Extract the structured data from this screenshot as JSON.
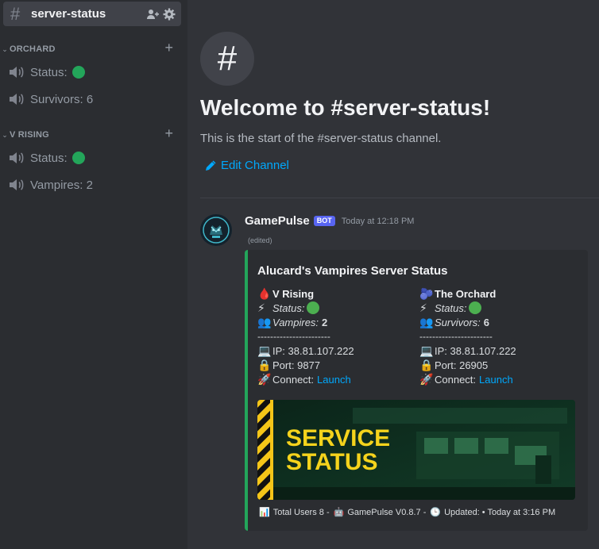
{
  "sidebar": {
    "active_channel": {
      "name": "server-status"
    },
    "categories": [
      {
        "label": "ORCHARD",
        "channels": [
          {
            "label": "Status:",
            "has_status_dot": true
          },
          {
            "label": "Survivors: 6"
          }
        ]
      },
      {
        "label": "V RISING",
        "channels": [
          {
            "label": "Status:",
            "has_status_dot": true
          },
          {
            "label": "Vampires: 2"
          }
        ]
      }
    ]
  },
  "main": {
    "channel_hash": "#",
    "welcome_title": "Welcome to #server-status!",
    "start_text": "This is the start of the #server-status channel.",
    "edit_channel_label": "Edit Channel"
  },
  "message": {
    "author": "GamePulse",
    "bot_badge": "BOT",
    "timestamp": "Today at 12:18 PM",
    "edited": "(edited)",
    "embed": {
      "accent_color": "#23a55a",
      "title": "Alucard's Vampires Server Status",
      "servers": [
        {
          "name": "V Rising",
          "status_label": "Status:",
          "count_label": "Vampires:",
          "count": "2",
          "separator": "-----------------------",
          "ip_label": "IP:",
          "ip": "38.81.107.222",
          "port_label": "Port:",
          "port": "9877",
          "connect_label": "Connect:",
          "connect_link": "Launch"
        },
        {
          "name": "The Orchard",
          "status_label": "Status:",
          "count_label": "Survivors:",
          "count": "6",
          "separator": "-----------------------",
          "ip_label": "IP:",
          "ip": "38.81.107.222",
          "port_label": "Port:",
          "port": "26905",
          "connect_label": "Connect:",
          "connect_link": "Launch"
        }
      ],
      "banner": {
        "line1": "SERVICE",
        "line2": "STATUS"
      },
      "footer": {
        "users": "Total Users 8 -",
        "version": "GamePulse V0.8.7 -",
        "updated": "Updated: • Today at 3:16 PM"
      }
    }
  }
}
